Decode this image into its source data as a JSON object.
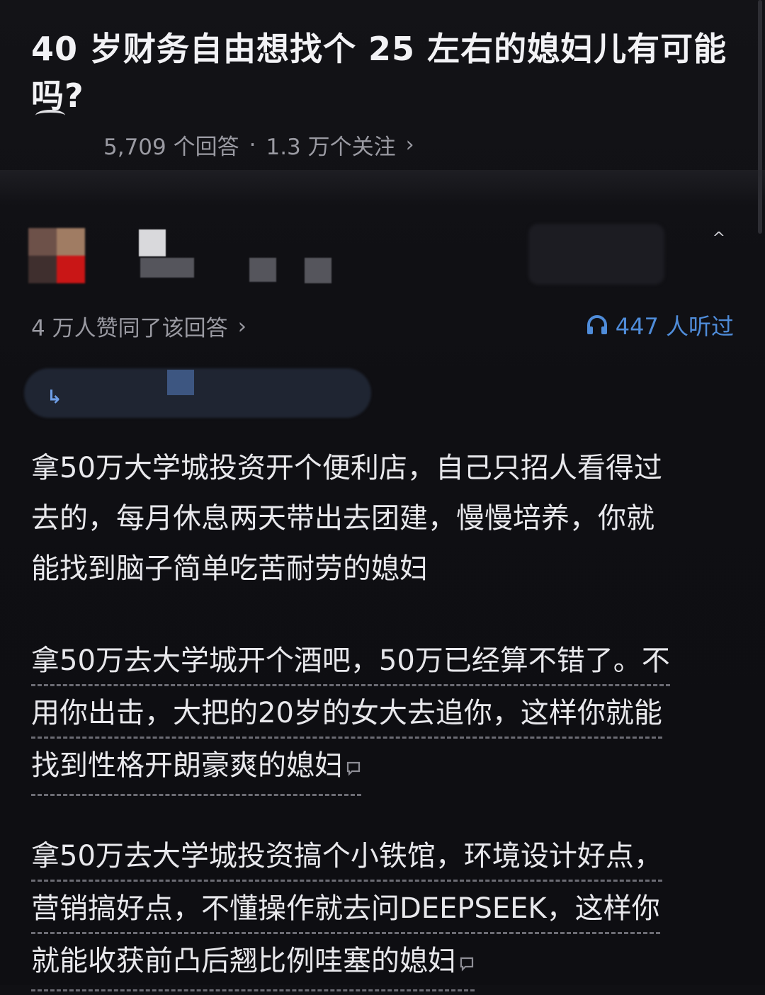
{
  "question": {
    "title": "40 岁财务自由想找个 25 左右的媳妇儿有可能吗?",
    "answers_count": "5,709 个回答",
    "separator": "·",
    "followers": "1.3 万个关注",
    "chevron": "›"
  },
  "answer_meta": {
    "approve_text": "4 万人赞同了该回答",
    "approve_chevron": "›",
    "listen_icon": "headphones-icon",
    "listen_text": "447 人听过"
  },
  "answer": {
    "p1_lines": [
      "拿50万大学城投资开个便利店，自己只招人看得过",
      "去的，每月休息两天带出去团建，慢慢培养，你就",
      "能找到脑子简单吃苦耐劳的媳妇"
    ],
    "p2_lines": [
      "拿50万去大学城开个酒吧，50万已经算不错了。不",
      "用你出击，大把的20岁的女大去追你，这样你就能",
      "找到性格开朗豪爽的媳妇"
    ],
    "p3_lines": [
      "拿50万去大学城投资搞个小铁馆，环境设计好点，",
      "营销搞好点，不懂操作就去问DEEPSEEK，这样你",
      "就能收获前凸后翘比例哇塞的媳妇"
    ],
    "comment_icon": "comment-bubble-icon"
  },
  "colors": {
    "background": "#101014",
    "accent_blue": "#4f8cd9",
    "muted_text": "#9a9aa2"
  }
}
